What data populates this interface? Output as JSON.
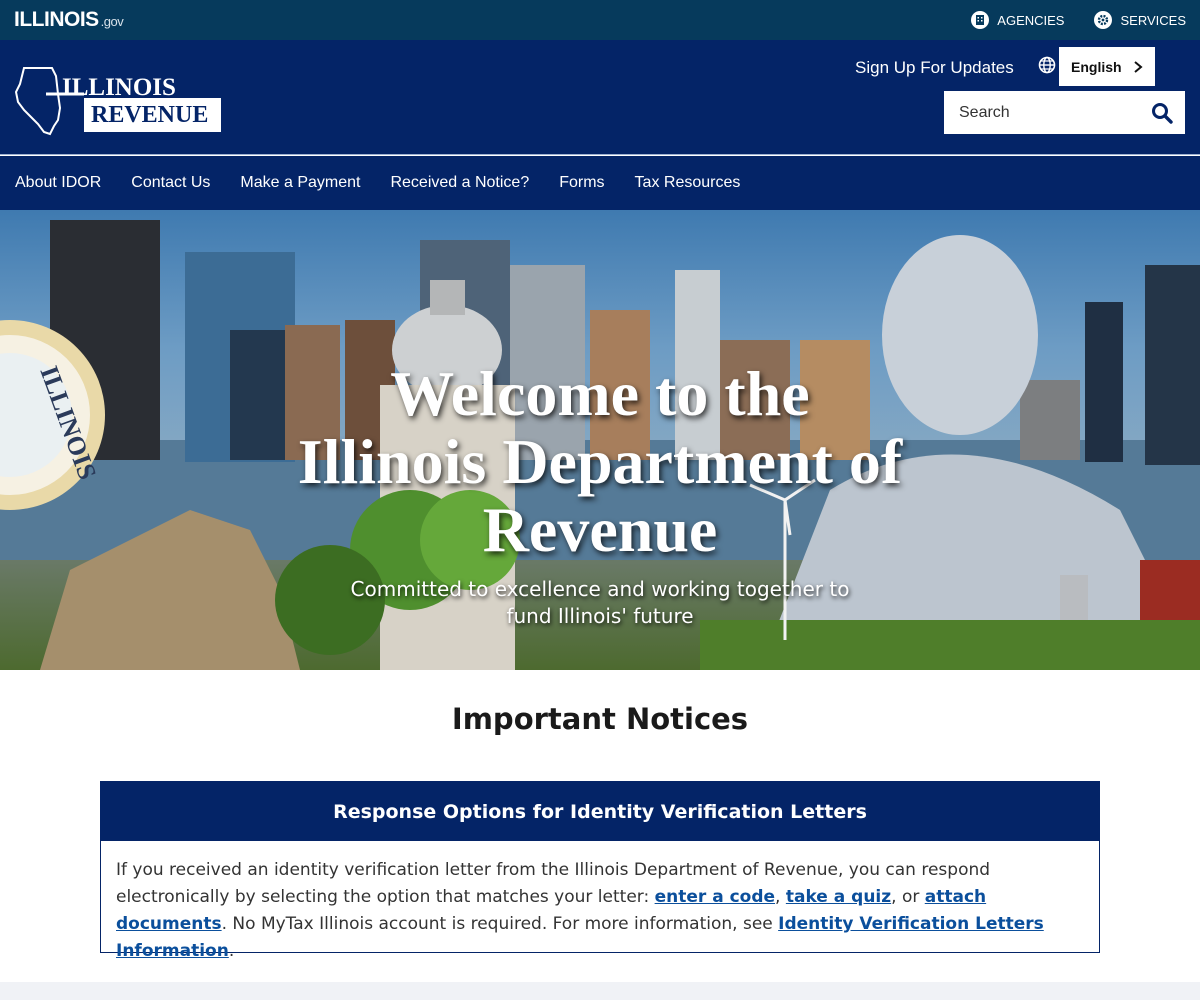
{
  "utility_bar": {
    "brand_main": "ILLINOIS",
    "brand_suffix": ".gov",
    "agencies_label": "AGENCIES",
    "services_label": "SERVICES"
  },
  "header": {
    "logo_line1": "ILLINOIS",
    "logo_line2": "REVENUE",
    "signup_label": "Sign Up For Updates",
    "language_label": "English",
    "search_placeholder": "Search"
  },
  "nav": {
    "items": [
      {
        "label": "About IDOR"
      },
      {
        "label": "Contact Us"
      },
      {
        "label": "Make a Payment"
      },
      {
        "label": "Received a Notice?"
      },
      {
        "label": "Forms"
      },
      {
        "label": "Tax Resources"
      }
    ]
  },
  "hero": {
    "title_line1": "Welcome to the",
    "title_line2": "Illinois Department of",
    "title_line3": "Revenue",
    "subtitle_line1": "Committed to excellence and working together to",
    "subtitle_line2": "fund Illinois' future",
    "seal_text": "ILLINOIS"
  },
  "notices": {
    "section_title": "Important Notices",
    "card_title": "Response Options for Identity Verification Letters",
    "body_part1": "If you received an identity verification letter from the Illinois Department of Revenue, you can respond electronically by selecting the option that matches your letter: ",
    "link_code": "enter a code",
    "sep1": ", ",
    "link_quiz": "take a quiz",
    "sep2": ", or ",
    "link_docs": "attach documents",
    "body_part2": ". No MyTax Illinois account is required. For more information, see ",
    "link_info": "Identity Verification Letters Information",
    "body_end": "."
  },
  "colors": {
    "utility_bar": "#063a5c",
    "header_navy": "#042467",
    "link_blue": "#0b4f9c"
  },
  "icons": {
    "agencies": "building-icon",
    "services": "gear-icon",
    "language": "globe-icon",
    "language_arrow": "chevron-right-icon",
    "search": "search-icon"
  }
}
